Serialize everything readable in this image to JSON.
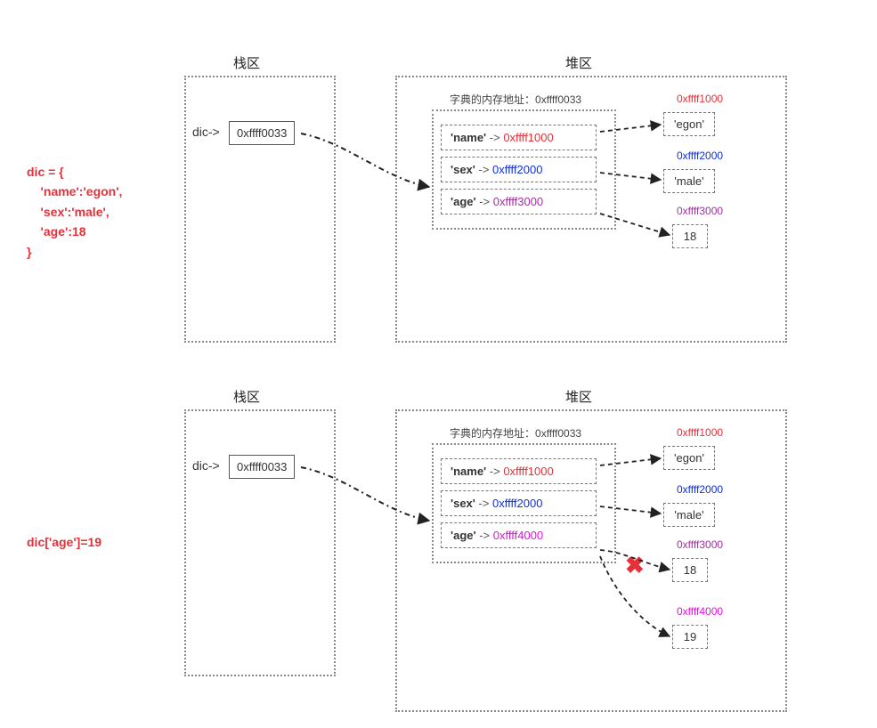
{
  "labels": {
    "stack": "栈区",
    "heap": "堆区",
    "dic_ptr": "dic->",
    "dict_addr_prefix": "字典的内存地址：",
    "arrow": "->"
  },
  "code1": "dic = {\n    'name':'egon',\n    'sex':'male',\n    'age':18\n}",
  "code2": "dic['age']=19",
  "diagram1": {
    "stack_addr": "0xffff0033",
    "dict_addr": "0xffff0033",
    "entries": [
      {
        "key": "'name'",
        "ptr": "0xffff1000",
        "color": "c-red"
      },
      {
        "key": "'sex'",
        "ptr": "0xffff2000",
        "color": "c-blue"
      },
      {
        "key": "'age'",
        "ptr": "0xffff3000",
        "color": "c-purple"
      }
    ],
    "values": [
      {
        "addr": "0xffff1000",
        "value": "'egon'",
        "addr_color": "c-red"
      },
      {
        "addr": "0xffff2000",
        "value": "'male'",
        "addr_color": "c-blue"
      },
      {
        "addr": "0xffff3000",
        "value": "18",
        "addr_color": "c-purple"
      }
    ]
  },
  "diagram2": {
    "stack_addr": "0xffff0033",
    "dict_addr": "0xffff0033",
    "entries": [
      {
        "key": "'name'",
        "ptr": "0xffff1000",
        "color": "c-red"
      },
      {
        "key": "'sex'",
        "ptr": "0xffff2000",
        "color": "c-blue"
      },
      {
        "key": "'age'",
        "ptr": "0xffff4000",
        "color": "c-magenta"
      }
    ],
    "values": [
      {
        "addr": "0xffff1000",
        "value": "'egon'",
        "addr_color": "c-red"
      },
      {
        "addr": "0xffff2000",
        "value": "'male'",
        "addr_color": "c-blue"
      },
      {
        "addr": "0xffff3000",
        "value": "18",
        "addr_color": "c-purple",
        "crossed": true
      },
      {
        "addr": "0xffff4000",
        "value": "19",
        "addr_color": "c-magenta"
      }
    ]
  }
}
